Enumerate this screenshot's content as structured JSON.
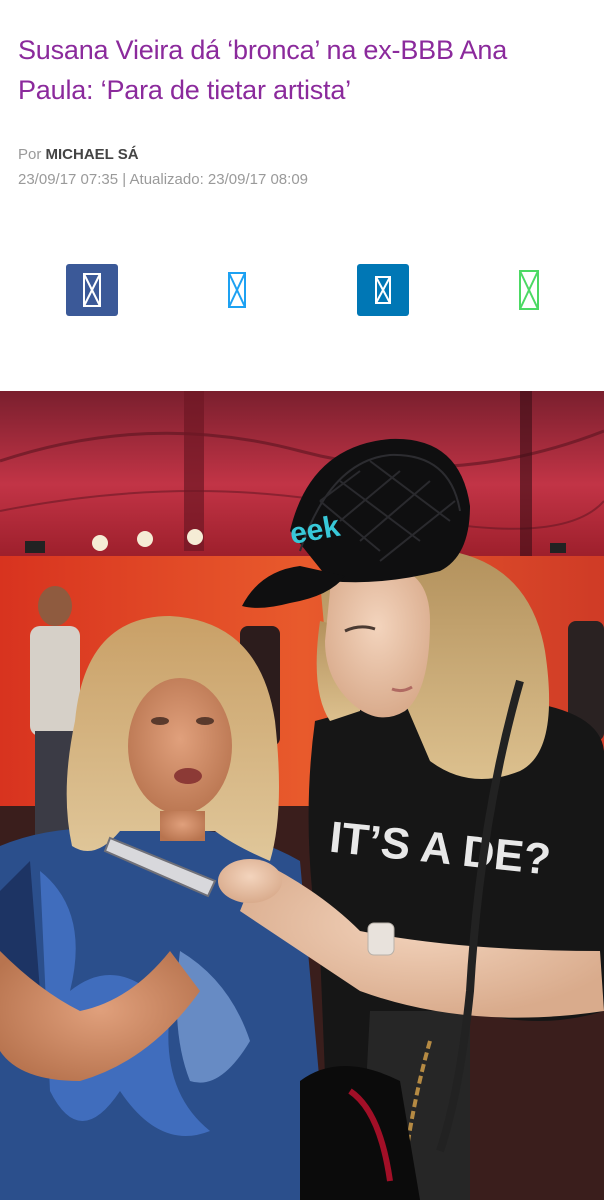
{
  "article": {
    "title": "Susana Vieira dá ‘bronca’ na ex-BBB Ana Paula: ‘Para de tietar artista’",
    "byline_prefix": "Por",
    "author": "MICHAEL SÁ",
    "published": "23/09/17 07:35",
    "separator": "|",
    "updated_label": "Atualizado:",
    "updated": "23/09/17 08:09"
  },
  "share": [
    {
      "name": "facebook-share",
      "icon": "missing-glyph-icon",
      "style": "filled",
      "color": "#3b5998"
    },
    {
      "name": "twitter-share",
      "icon": "missing-glyph-icon",
      "style": "outline",
      "color": "#1da1f2"
    },
    {
      "name": "linkedin-share",
      "icon": "missing-glyph-icon",
      "style": "filled",
      "color": "#0077b5"
    },
    {
      "name": "whatsapp-share",
      "icon": "missing-glyph-icon",
      "style": "outline",
      "color": "#4cd964"
    }
  ],
  "photo": {
    "shirt_print": "IT’S A DE?",
    "cap_print": "eek"
  },
  "colors": {
    "headline": "#8b2a9c",
    "meta": "#9a9a9a",
    "author": "#444444"
  }
}
